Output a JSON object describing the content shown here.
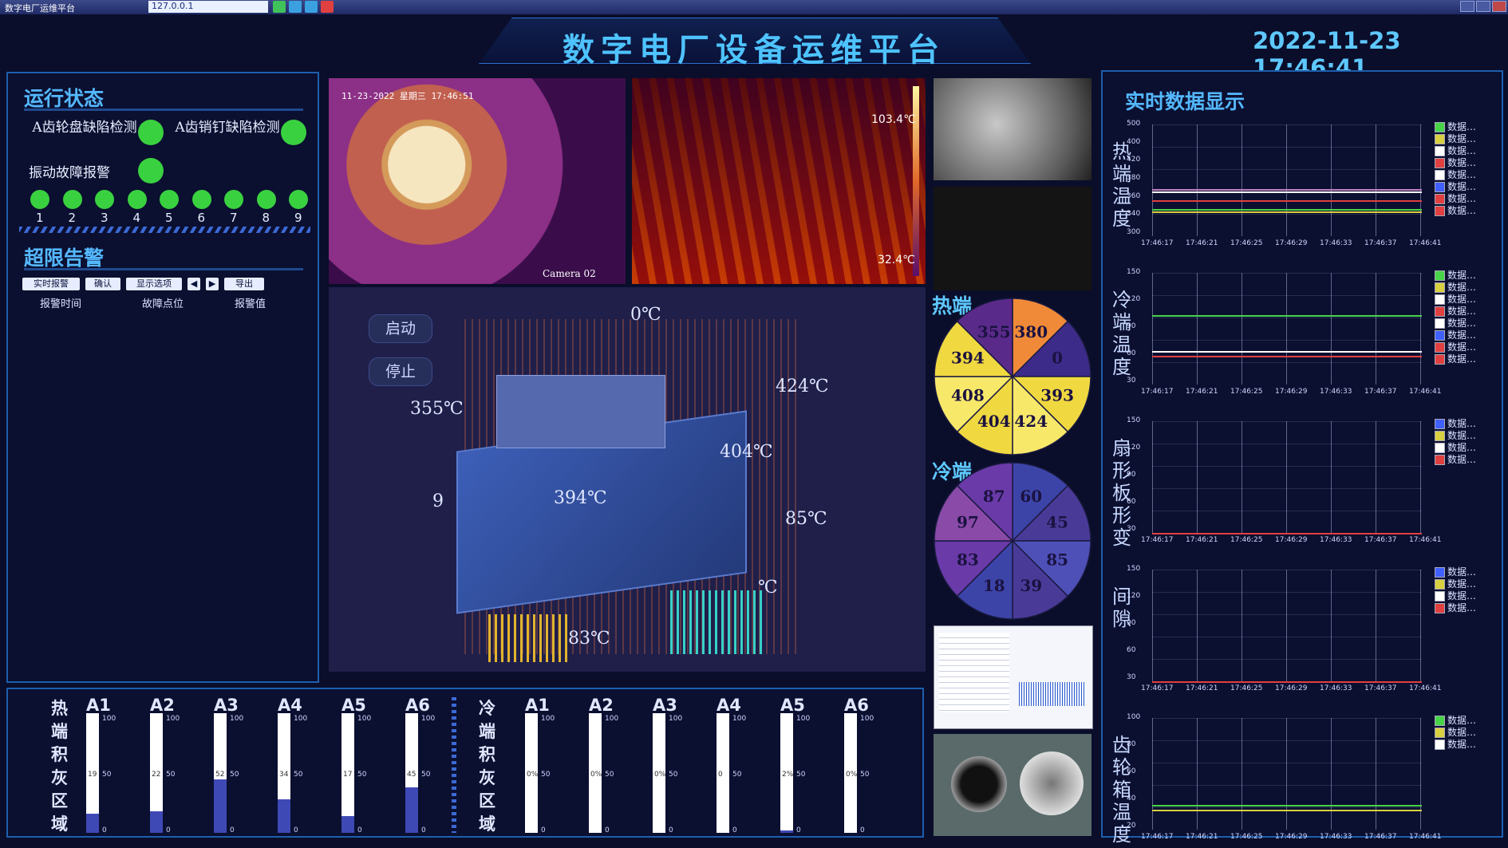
{
  "window": {
    "app_name": "数字电厂运维平台",
    "address": "127.0.0.1"
  },
  "header": {
    "title": "数字电厂设备运维平台",
    "datetime": "2022-11-23  17:46:41"
  },
  "status": {
    "title": "运行状态",
    "items": [
      {
        "label": "A齿轮盘缺陷检测",
        "state": "ok"
      },
      {
        "label": "A齿销钉缺陷检测",
        "state": "ok"
      },
      {
        "label": "振动故障报警",
        "state": "ok"
      }
    ],
    "leds": [
      "1",
      "2",
      "3",
      "4",
      "5",
      "6",
      "7",
      "8",
      "9"
    ]
  },
  "alarm": {
    "title": "超限告警",
    "toolbar": [
      "实时报警",
      "确认",
      "显示选项",
      "◀",
      "▶",
      "导出"
    ],
    "columns": [
      "报警时间",
      "故障点位",
      "报警值"
    ]
  },
  "camera": {
    "timestamp": "11-23-2022 星期三 17:46:51",
    "name": "Camera 02",
    "max": "103.4℃",
    "min": "32.4℃"
  },
  "controls": {
    "start": "启动",
    "stop": "停止"
  },
  "model_temps": [
    "0℃",
    "424℃",
    "355℃",
    "404℃",
    "394℃",
    "9",
    "85℃",
    "83℃",
    "℃"
  ],
  "hot_end": {
    "title": "热端",
    "values": [
      "380",
      "0",
      "393",
      "424",
      "404",
      "408",
      "394",
      "355"
    ]
  },
  "cold_end": {
    "title": "冷端",
    "values": [
      "60",
      "45",
      "85",
      "39",
      "18",
      "83",
      "97",
      "87"
    ]
  },
  "realtime": {
    "title": "实时数据显示",
    "legend_label": "数据…",
    "charts": [
      {
        "label": "热端温度",
        "ymax": "500",
        "yticks": [
          "500",
          "400",
          "420",
          "380",
          "360",
          "340",
          "300"
        ],
        "legend_colors": [
          "#48d448",
          "#d8d040",
          "#ffffff",
          "#e04040",
          "#ffffff",
          "#4060ff",
          "#e04040",
          "#e04040"
        ]
      },
      {
        "label": "冷端温度",
        "ymax": "150",
        "yticks": [
          "150",
          "120",
          "90",
          "60",
          "30"
        ],
        "legend_colors": [
          "#48d448",
          "#d8d040",
          "#ffffff",
          "#e04040",
          "#ffffff",
          "#4060ff",
          "#e04040",
          "#e04040"
        ]
      },
      {
        "label": "扇形板形变",
        "ymax": "150",
        "yticks": [
          "150",
          "120",
          "90",
          "60",
          "30"
        ],
        "legend_colors": [
          "#4060ff",
          "#d8d040",
          "#ffffff",
          "#e04040"
        ]
      },
      {
        "label": "间隙",
        "ymax": "150",
        "yticks": [
          "150",
          "120",
          "90",
          "60",
          "30"
        ],
        "legend_colors": [
          "#4060ff",
          "#d8d040",
          "#ffffff",
          "#e04040"
        ]
      },
      {
        "label": "齿轮箱温度",
        "ymax": "100",
        "yticks": [
          "100",
          "80",
          "60",
          "40",
          "20"
        ],
        "legend_colors": [
          "#48d448",
          "#d8d040",
          "#ffffff"
        ]
      }
    ],
    "xticks": [
      "17:46:17",
      "17:46:21",
      "17:46:25",
      "17:46:29",
      "17:46:33",
      "17:46:37",
      "17:46:41"
    ]
  },
  "ash_hot": {
    "label": "热端积灰区域",
    "tubes": [
      {
        "name": "A1",
        "value": 19,
        "fill": 0.16
      },
      {
        "name": "A2",
        "value": 22,
        "fill": 0.18
      },
      {
        "name": "A3",
        "value": 52,
        "fill": 0.45
      },
      {
        "name": "A4",
        "value": 34,
        "fill": 0.28
      },
      {
        "name": "A5",
        "value": 17,
        "fill": 0.14
      },
      {
        "name": "A6",
        "value": 45,
        "fill": 0.38
      }
    ]
  },
  "ash_cold": {
    "label": "冷端积灰区域",
    "tubes": [
      {
        "name": "A1",
        "value": "0%",
        "fill": 0
      },
      {
        "name": "A2",
        "value": "0%",
        "fill": 0
      },
      {
        "name": "A3",
        "value": "0%",
        "fill": 0
      },
      {
        "name": "A4",
        "value": "0",
        "fill": 0
      },
      {
        "name": "A5",
        "value": "2%",
        "fill": 0.02
      },
      {
        "name": "A6",
        "value": "0%",
        "fill": 0
      }
    ]
  },
  "tube_scale": [
    "100",
    "50",
    "0"
  ],
  "colors": {
    "accent": "#4ec3ff",
    "led_green": "#3ad140",
    "fill_blue": "#3f49b5",
    "panel_border": "#1d5fae"
  }
}
